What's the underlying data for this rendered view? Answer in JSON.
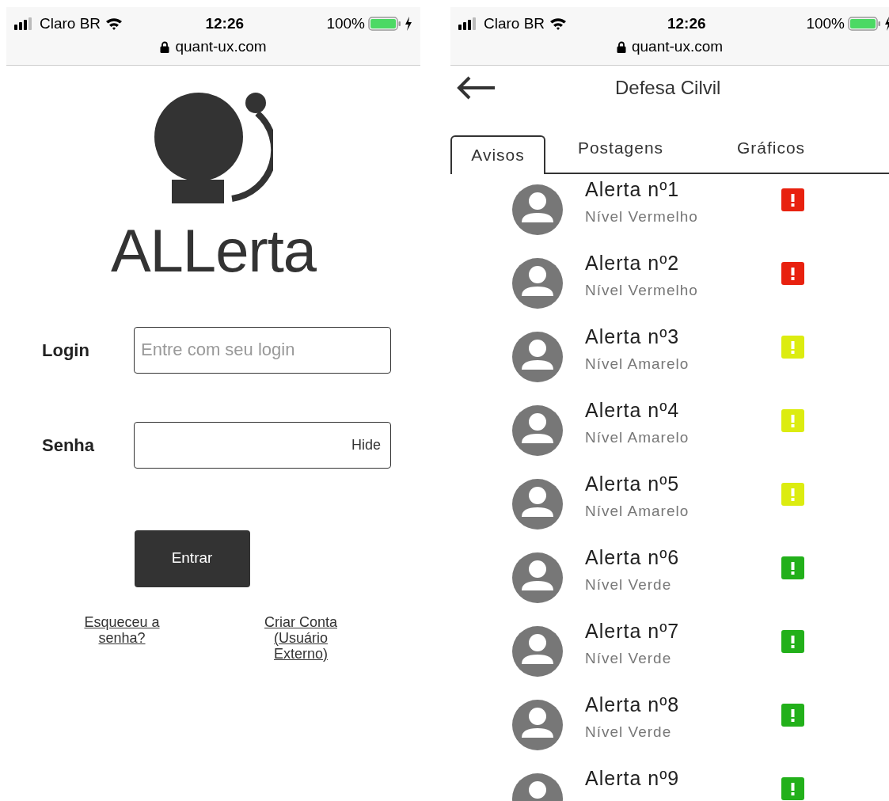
{
  "screens": [
    {
      "kind": "login",
      "status_bar": {
        "carrier": "Claro BR",
        "time": "12:26",
        "battery": "100%"
      },
      "url": "quant-ux.com",
      "app_name": "ALLerta",
      "fields": [
        {
          "label": "Login",
          "placeholder": "Entre com seu login"
        },
        {
          "label": "Senha",
          "toggle": "Hide"
        }
      ],
      "button": "Entrar",
      "links": [
        "Esqueceu a senha?",
        "Criar Conta (Usuário Externo)"
      ]
    },
    {
      "kind": "list",
      "status_bar": {
        "carrier": "Claro BR",
        "time": "12:26",
        "battery": "100%"
      },
      "url": "quant-ux.com",
      "title": "Defesa Cilvil",
      "tabs": [
        {
          "label": "Avisos",
          "selected": true
        },
        {
          "label": "Postagens",
          "selected": false
        },
        {
          "label": "Gráficos",
          "selected": false
        }
      ],
      "alerts": [
        {
          "title": "Alerta nº1",
          "subtitle": "Nível Vermelho",
          "color": "#e8210f"
        },
        {
          "title": "Alerta nº2",
          "subtitle": "Nível Vermelho",
          "color": "#e8210f"
        },
        {
          "title": "Alerta nº3",
          "subtitle": "Nível Amarelo",
          "color": "#dcec10"
        },
        {
          "title": "Alerta nº4",
          "subtitle": "Nível Amarelo",
          "color": "#dcec10"
        },
        {
          "title": "Alerta nº5",
          "subtitle": "Nível Amarelo",
          "color": "#dcec10"
        },
        {
          "title": "Alerta nº6",
          "subtitle": "Nível Verde",
          "color": "#22b01a"
        },
        {
          "title": "Alerta nº7",
          "subtitle": "Nível Verde",
          "color": "#22b01a"
        },
        {
          "title": "Alerta nº8",
          "subtitle": "Nível Verde",
          "color": "#22b01a"
        },
        {
          "title": "Alerta nº9",
          "color": "#22b01a"
        }
      ]
    }
  ]
}
